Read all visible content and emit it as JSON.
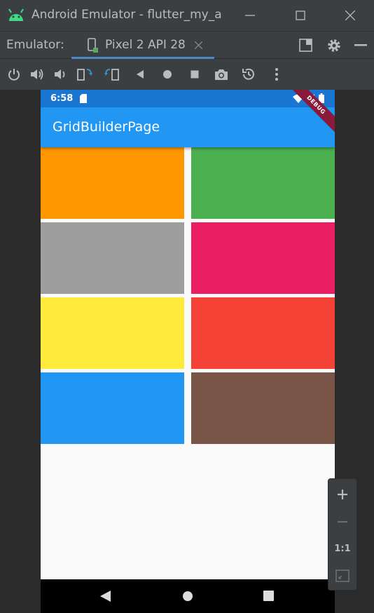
{
  "window": {
    "title": "Android Emulator - flutter_my_a",
    "minimize_icon": "minimize-icon",
    "maximize_icon": "maximize-icon",
    "close_icon": "close-icon"
  },
  "tabbar": {
    "label": "Emulator:",
    "tab_label": "Pixel 2 API 28"
  },
  "toolbar": {
    "icons": [
      "power-icon",
      "volume-up-icon",
      "volume-down-icon",
      "rotate-left-icon",
      "rotate-right-icon",
      "back-icon",
      "home-icon",
      "overview-icon",
      "screenshot-icon",
      "snapshot-icon",
      "more-icon"
    ]
  },
  "phone": {
    "time": "6:58",
    "app_title": "GridBuilderPage",
    "debug_banner": "DEBUG",
    "grid_colors": [
      "#ff9800",
      "#4caf50",
      "#9e9e9e",
      "#e91e63",
      "#ffeb3b",
      "#f44336",
      "#2196f3",
      "#795548"
    ],
    "nav_icons": [
      "nav-back-icon",
      "nav-home-icon",
      "nav-recents-icon"
    ]
  },
  "zoom": {
    "one_to_one": "1:1"
  },
  "colors": {
    "accent": "#4a88c7",
    "appbar": "#2196f3",
    "statusbar": "#1976d2"
  }
}
